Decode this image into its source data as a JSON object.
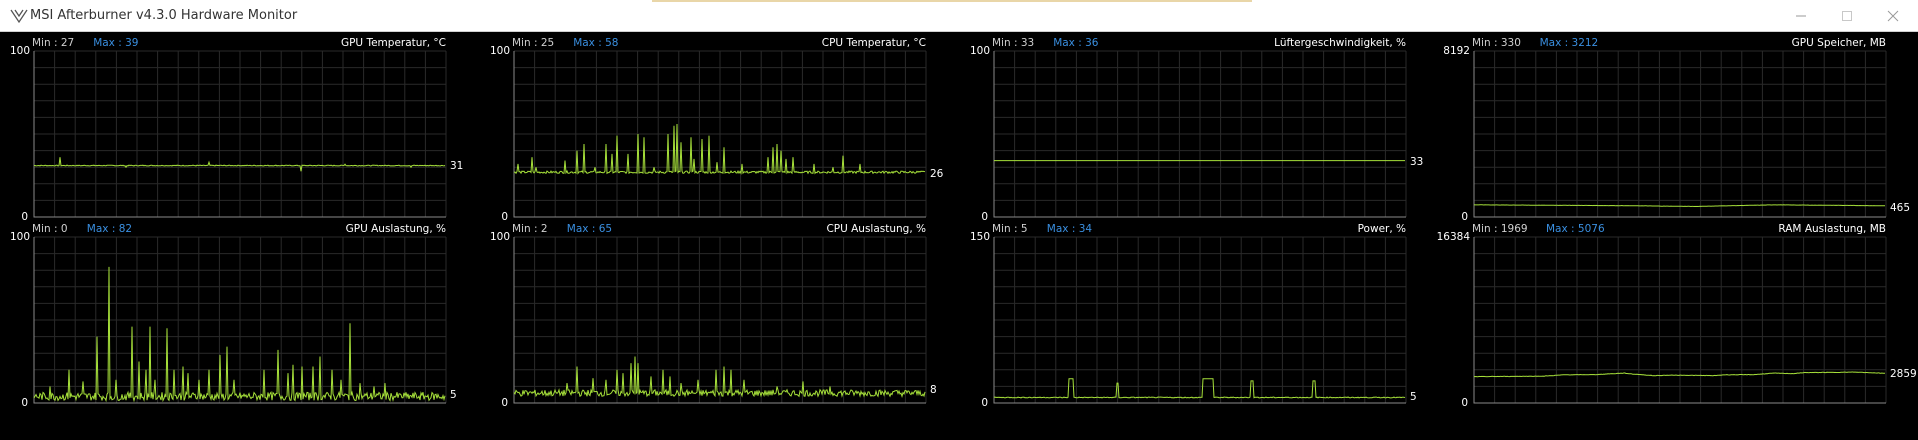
{
  "window": {
    "title": "MSI Afterburner v4.3.0 Hardware Monitor"
  },
  "colors": {
    "line": "#a6e03a",
    "grid": "#2a2a2a",
    "axis": "#8a8a8a",
    "min": "#d0d0d0",
    "max": "#3a8fe0"
  },
  "graphs": [
    {
      "name": "GPU Temperatur, °C",
      "min_label": "Min : 27",
      "max_label": "Max : 39",
      "y_max": "100",
      "y_min": "0",
      "current": "31",
      "range": [
        0,
        100
      ],
      "baseline": 31,
      "noise": 0.25,
      "spikes": [
        [
          30,
          36
        ],
        [
          105,
          30
        ],
        [
          200,
          33
        ],
        [
          305,
          27.5
        ],
        [
          355,
          31.8
        ],
        [
          430,
          30
        ]
      ]
    },
    {
      "name": "CPU Temperatur, °C",
      "min_label": "Min : 25",
      "max_label": "Max : 58",
      "y_max": "100",
      "y_min": "0",
      "current": "26",
      "range": [
        0,
        100
      ],
      "baseline": 27,
      "noise": 0.7,
      "spikes": [
        [
          5,
          32
        ],
        [
          20,
          36
        ],
        [
          25,
          30
        ],
        [
          58,
          34
        ],
        [
          72,
          40
        ],
        [
          80,
          44
        ],
        [
          92,
          30
        ],
        [
          105,
          44
        ],
        [
          112,
          38
        ],
        [
          118,
          49
        ],
        [
          130,
          38
        ],
        [
          142,
          50
        ],
        [
          148,
          48
        ],
        [
          160,
          30
        ],
        [
          176,
          50
        ],
        [
          182,
          55
        ],
        [
          186,
          56
        ],
        [
          190,
          45
        ],
        [
          202,
          48
        ],
        [
          205,
          35
        ],
        [
          215,
          47
        ],
        [
          222,
          49
        ],
        [
          232,
          33
        ],
        [
          240,
          42
        ],
        [
          260,
          32
        ],
        [
          290,
          36
        ],
        [
          296,
          42
        ],
        [
          300,
          44
        ],
        [
          305,
          40
        ],
        [
          310,
          35
        ],
        [
          318,
          36
        ],
        [
          342,
          32
        ],
        [
          364,
          30
        ],
        [
          375,
          37
        ],
        [
          395,
          32
        ]
      ]
    },
    {
      "name": "Lüftergeschwindigkeit, %",
      "min_label": "Min : 33",
      "max_label": "Max : 36",
      "y_max": "100",
      "y_min": "0",
      "current": "33",
      "range": [
        0,
        100
      ],
      "baseline": 34,
      "noise": 0,
      "spikes": []
    },
    {
      "name": "GPU Speicher, MB",
      "min_label": "Min : 330",
      "max_label": "Max : 3212",
      "y_max": "8192",
      "y_min": "0",
      "current": "465",
      "range": [
        0,
        8192
      ],
      "baseline": 560,
      "noise": 5,
      "drift": [
        [
          0,
          600
        ],
        [
          150,
          560
        ],
        [
          220,
          520
        ],
        [
          300,
          600
        ],
        [
          400,
          560
        ],
        [
          470,
          520
        ]
      ],
      "spikes": []
    },
    {
      "name": "GPU Auslastung, %",
      "min_label": "Min : 0",
      "max_label": "Max : 82",
      "y_max": "100",
      "y_min": "0",
      "current": "5",
      "range": [
        0,
        100
      ],
      "baseline": 4,
      "noise": 2.5,
      "spikes": [
        [
          18,
          10
        ],
        [
          40,
          20
        ],
        [
          56,
          13
        ],
        [
          72,
          40
        ],
        [
          86,
          82
        ],
        [
          94,
          14
        ],
        [
          112,
          46
        ],
        [
          120,
          25
        ],
        [
          128,
          20
        ],
        [
          132,
          46
        ],
        [
          138,
          14
        ],
        [
          152,
          45
        ],
        [
          160,
          20
        ],
        [
          170,
          22
        ],
        [
          176,
          18
        ],
        [
          188,
          14
        ],
        [
          200,
          20
        ],
        [
          212,
          29
        ],
        [
          220,
          34
        ],
        [
          228,
          14
        ],
        [
          262,
          20
        ],
        [
          278,
          32
        ],
        [
          290,
          18
        ],
        [
          296,
          23
        ],
        [
          306,
          22
        ],
        [
          318,
          22
        ],
        [
          326,
          28
        ],
        [
          340,
          20
        ],
        [
          350,
          14
        ],
        [
          360,
          48
        ],
        [
          372,
          12
        ],
        [
          388,
          10
        ],
        [
          400,
          12
        ]
      ]
    },
    {
      "name": "CPU Auslastung, %",
      "min_label": "Min : 2",
      "max_label": "Max : 65",
      "y_max": "100",
      "y_min": "0",
      "current": "8",
      "range": [
        0,
        100
      ],
      "baseline": 6,
      "noise": 2,
      "spikes": [
        [
          60,
          12
        ],
        [
          72,
          22
        ],
        [
          90,
          15
        ],
        [
          105,
          14
        ],
        [
          118,
          20
        ],
        [
          124,
          18
        ],
        [
          134,
          24
        ],
        [
          138,
          28
        ],
        [
          142,
          24
        ],
        [
          156,
          16
        ],
        [
          170,
          20
        ],
        [
          178,
          16
        ],
        [
          190,
          12
        ],
        [
          210,
          14
        ],
        [
          230,
          20
        ],
        [
          240,
          22
        ],
        [
          248,
          20
        ],
        [
          262,
          14
        ],
        [
          300,
          10
        ],
        [
          330,
          13
        ],
        [
          360,
          10
        ]
      ]
    },
    {
      "name": "Power, %",
      "min_label": "Min : 5",
      "max_label": "Max : 34",
      "y_max": "150",
      "y_min": "0",
      "current": "5",
      "range": [
        0,
        150
      ],
      "baseline": 5,
      "noise": 0.4,
      "pulses": [
        [
          86,
          90,
          22
        ],
        [
          140,
          142,
          18
        ],
        [
          238,
          250,
          22
        ],
        [
          293,
          295,
          20
        ],
        [
          364,
          366,
          20
        ]
      ],
      "spikes": []
    },
    {
      "name": "RAM Auslastung, MB",
      "min_label": "Min : 1969",
      "max_label": "Max : 5076",
      "y_max": "16384",
      "y_min": "0",
      "current": "2859",
      "range": [
        0,
        16384
      ],
      "baseline": 2800,
      "noise": 20,
      "drift": [
        [
          0,
          2600
        ],
        [
          70,
          2650
        ],
        [
          90,
          2780
        ],
        [
          120,
          2800
        ],
        [
          150,
          2950
        ],
        [
          160,
          2850
        ],
        [
          180,
          2700
        ],
        [
          200,
          2750
        ],
        [
          240,
          2700
        ],
        [
          250,
          2780
        ],
        [
          280,
          2800
        ],
        [
          300,
          2950
        ],
        [
          320,
          2900
        ],
        [
          330,
          3000
        ],
        [
          360,
          3020
        ],
        [
          380,
          3050
        ],
        [
          400,
          2980
        ],
        [
          420,
          2900
        ],
        [
          470,
          2860
        ]
      ],
      "spikes": []
    }
  ]
}
